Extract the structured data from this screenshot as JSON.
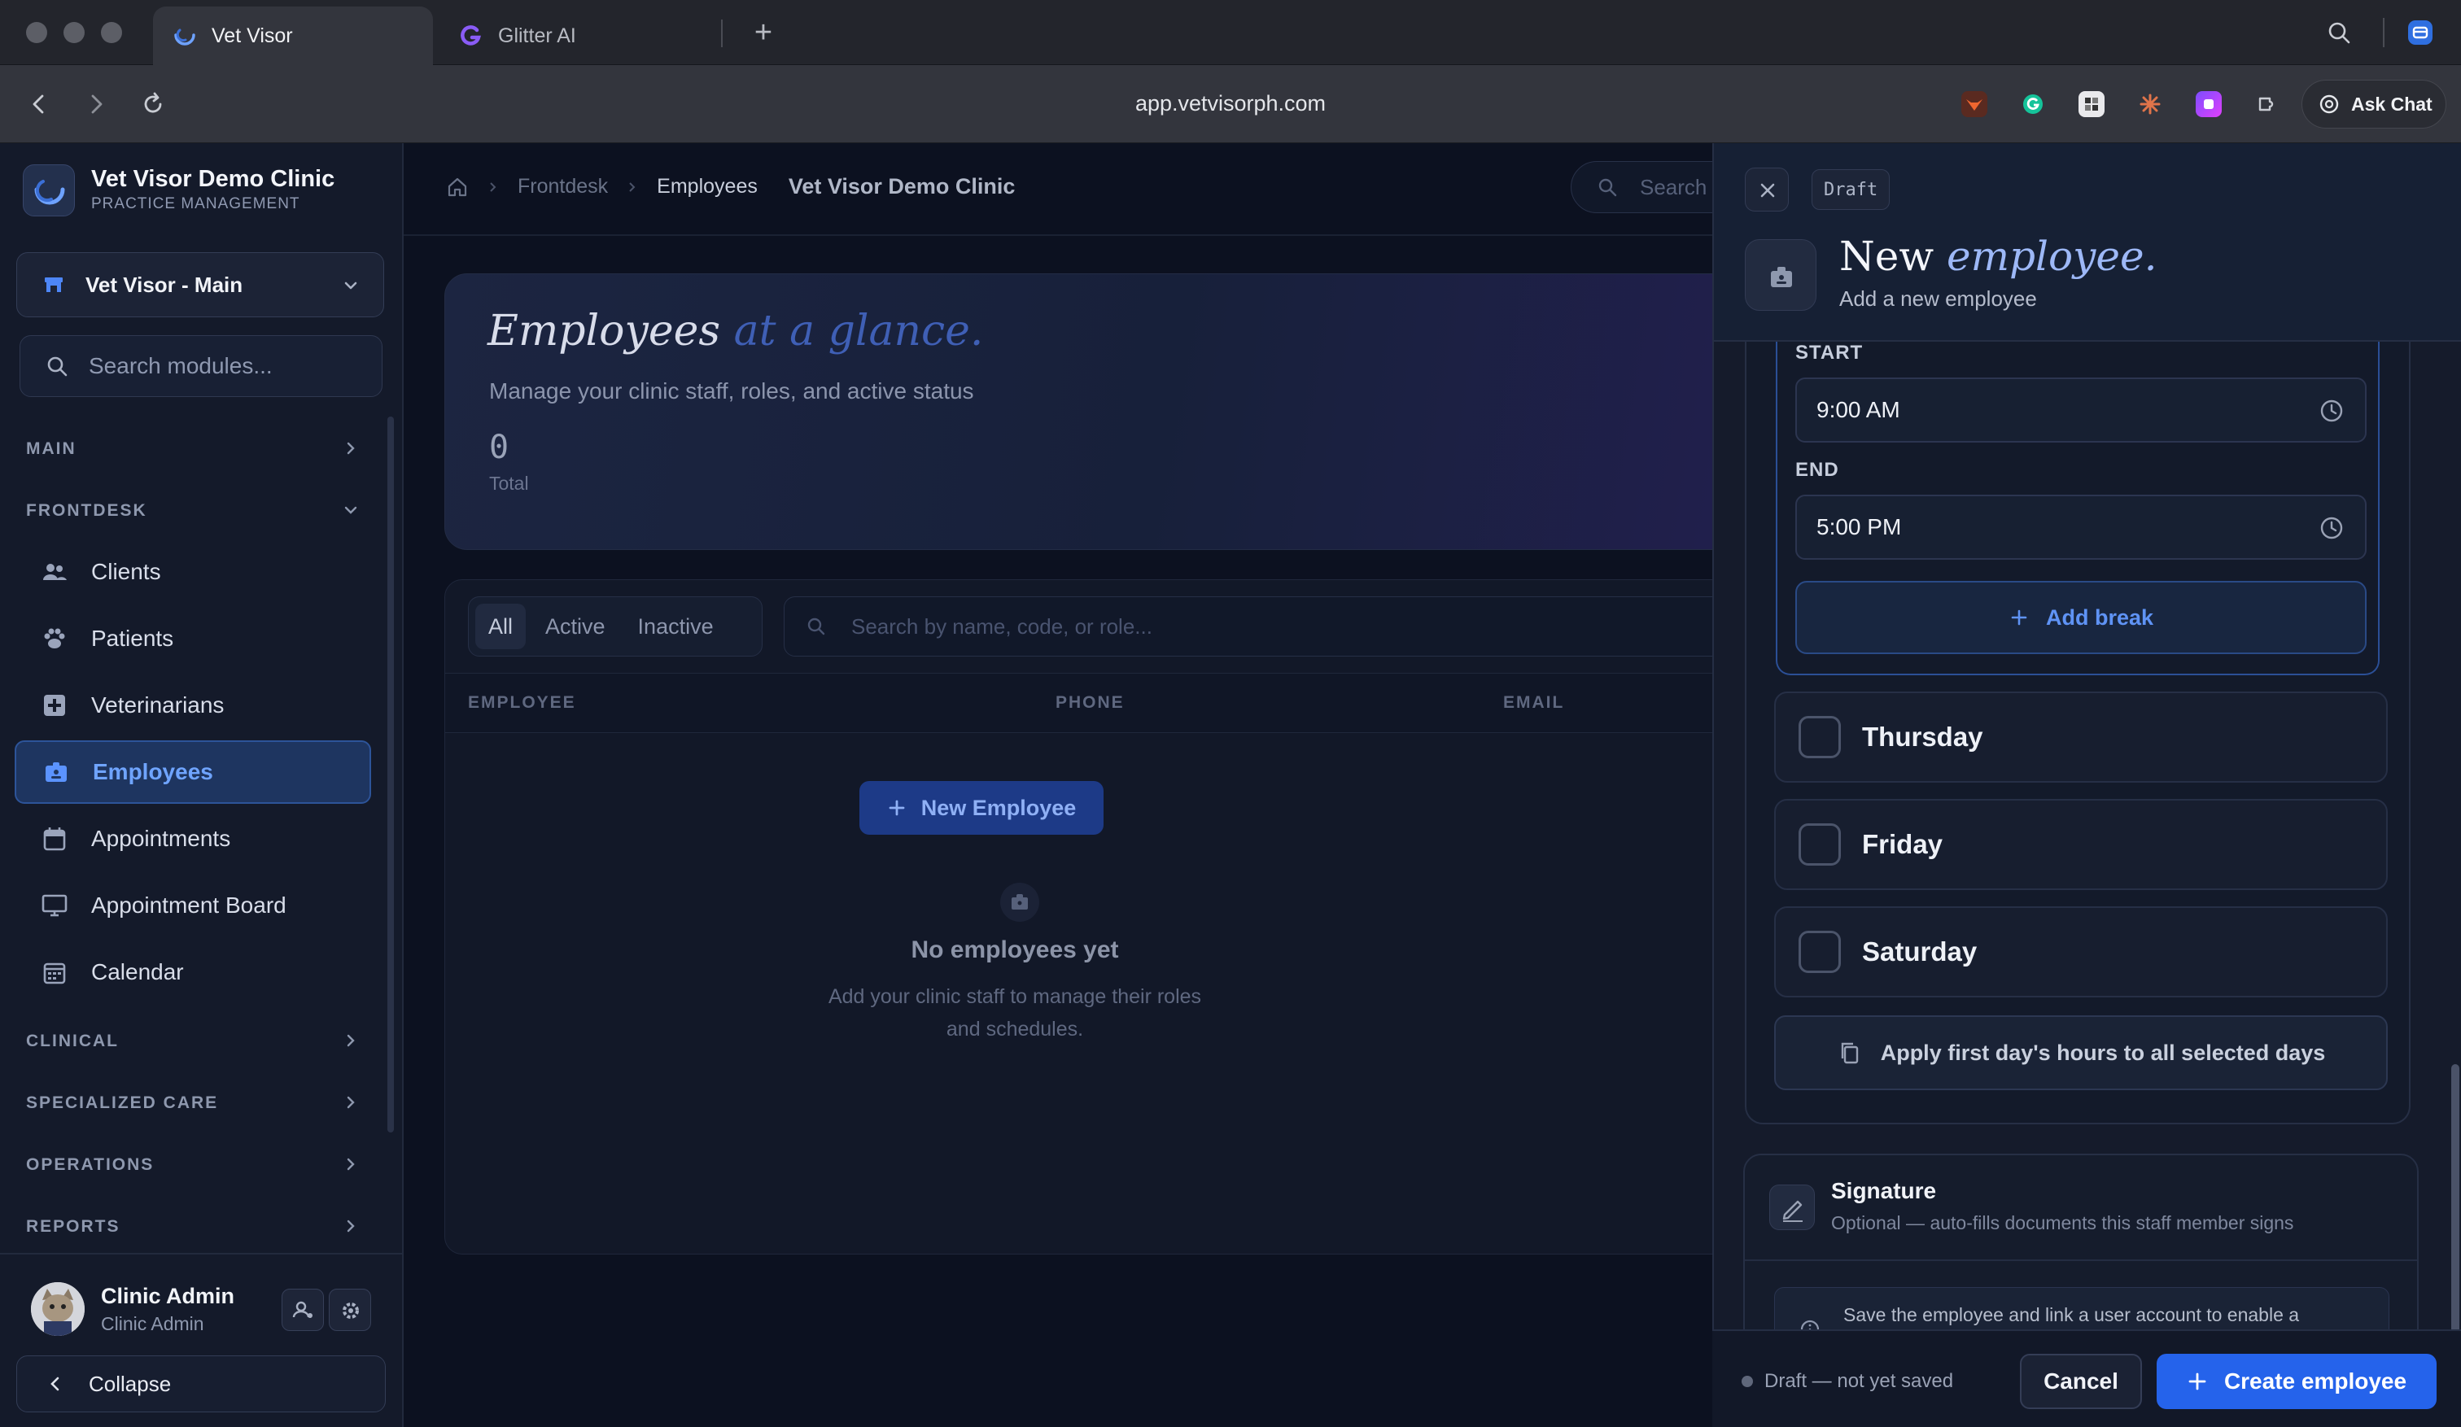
{
  "browser": {
    "tabs": [
      {
        "label": "Vet Visor",
        "icon": "vet-visor-logo-icon",
        "active": true
      },
      {
        "label": "Glitter AI",
        "icon": "glitter-ai-logo-icon",
        "active": false
      }
    ],
    "url": "app.vetvisorph.com",
    "ask_chat_label": "Ask Chat"
  },
  "sidebar": {
    "clinic_name": "Vet Visor Demo Clinic",
    "clinic_subtitle": "PRACTICE MANAGEMENT",
    "branch": "Vet Visor - Main",
    "search_placeholder": "Search modules...",
    "sections": {
      "main": "MAIN",
      "frontdesk": "FRONTDESK",
      "clinical": "CLINICAL",
      "specialized_care": "SPECIALIZED CARE",
      "operations": "OPERATIONS",
      "reports": "REPORTS"
    },
    "items": [
      {
        "label": "Clients",
        "icon": "users-icon"
      },
      {
        "label": "Patients",
        "icon": "paw-icon"
      },
      {
        "label": "Veterinarians",
        "icon": "medical-cross-icon"
      },
      {
        "label": "Employees",
        "icon": "id-badge-icon",
        "active": true
      },
      {
        "label": "Appointments",
        "icon": "calendar-icon"
      },
      {
        "label": "Appointment Board",
        "icon": "monitor-icon"
      },
      {
        "label": "Calendar",
        "icon": "calendar-grid-icon"
      }
    ],
    "user": {
      "name": "Clinic Admin",
      "role": "Clinic Admin"
    },
    "collapse_label": "Collapse"
  },
  "main": {
    "breadcrumb": {
      "section": "Frontdesk",
      "page": "Employees",
      "clinic": "Vet Visor Demo Clinic"
    },
    "search_placeholder": "Search",
    "hero": {
      "title_main": "Employees",
      "title_accent": "at a glance.",
      "subtitle": "Manage your clinic staff, roles, and active status",
      "total_value": "0",
      "total_label": "Total"
    },
    "filters": [
      "All",
      "Active",
      "Inactive"
    ],
    "active_filter": "All",
    "table_search_placeholder": "Search by name, code, or role...",
    "columns": [
      "EMPLOYEE",
      "PHONE",
      "EMAIL"
    ],
    "empty": {
      "title": "No employees yet",
      "subtitle": "Add your clinic staff to manage their roles and schedules.",
      "button": "New Employee"
    }
  },
  "drawer": {
    "draft_tag": "Draft",
    "title_main": "New",
    "title_accent": "employee.",
    "subtitle": "Add a new employee",
    "schedule": {
      "start_label": "START",
      "start_value": "9:00 AM",
      "end_label": "END",
      "end_value": "5:00 PM",
      "add_break": "Add break",
      "days": [
        {
          "label": "Thursday",
          "checked": false
        },
        {
          "label": "Friday",
          "checked": false
        },
        {
          "label": "Saturday",
          "checked": false
        }
      ],
      "apply_all": "Apply first day's hours to all selected days"
    },
    "signature": {
      "title": "Signature",
      "subtitle": "Optional — auto-fills documents this staff member signs",
      "note": "Save the employee and link a user account to enable a"
    },
    "footer": {
      "status": "Draft — not yet saved",
      "cancel": "Cancel",
      "create": "Create employee"
    }
  },
  "colors": {
    "accent": "#2563eb",
    "active_nav_text": "#6fa4ff",
    "drawer_title_accent": "#9db8f7"
  }
}
